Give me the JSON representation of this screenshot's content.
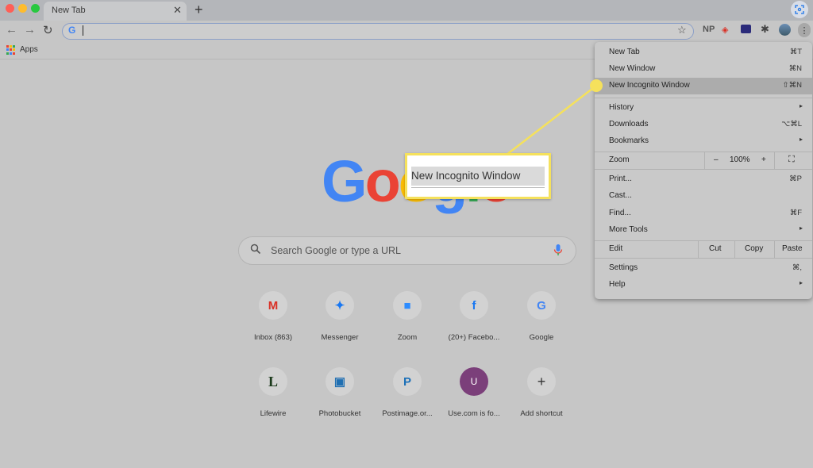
{
  "browser": {
    "tab_title": "New Tab",
    "tab_close": "✕",
    "new_tab": "+",
    "extensions": {
      "np": "NP"
    }
  },
  "bookmarks": {
    "apps_label": "Apps"
  },
  "logo": {
    "letters": [
      "G",
      "o",
      "o",
      "g",
      "l",
      "e"
    ],
    "colors": [
      "#4285f4",
      "#ea4335",
      "#fbbc05",
      "#4285f4",
      "#34a853",
      "#ea4335"
    ]
  },
  "search": {
    "placeholder": "Search Google or type a URL"
  },
  "shortcuts": [
    {
      "label": "Inbox (863)",
      "glyph": "M",
      "color": "#d93025",
      "icon": "gmail-icon"
    },
    {
      "label": "Messenger",
      "glyph": "✦",
      "color": "#1877f2",
      "icon": "messenger-icon"
    },
    {
      "label": "Zoom",
      "glyph": "■",
      "color": "#2d8cff",
      "icon": "zoom-icon"
    },
    {
      "label": "(20+) Facebo...",
      "glyph": "f",
      "color": "#1877f2",
      "icon": "facebook-icon"
    },
    {
      "label": "Google",
      "glyph": "G",
      "color": "#4285f4",
      "icon": "google-icon"
    },
    {
      "label": "Lifewire",
      "glyph": "L",
      "color": "#1b3a1b",
      "icon": "lifewire-icon"
    },
    {
      "label": "Photobucket",
      "glyph": "▣",
      "color": "#1f6fb2",
      "icon": "photobucket-icon"
    },
    {
      "label": "Postimage.or...",
      "glyph": "P",
      "color": "#1c70b8",
      "icon": "postimage-icon"
    },
    {
      "label": "Use.com is fo...",
      "glyph": "U",
      "color": "#ffffff",
      "icon": "usecom-icon"
    },
    {
      "label": "Add shortcut",
      "glyph": "+",
      "color": "#333333",
      "icon": "plus-icon"
    }
  ],
  "menu": {
    "new_tab": {
      "label": "New Tab",
      "shortcut": "⌘T"
    },
    "new_window": {
      "label": "New Window",
      "shortcut": "⌘N"
    },
    "new_incognito": {
      "label": "New Incognito Window",
      "shortcut": "⇧⌘N"
    },
    "history": {
      "label": "History"
    },
    "downloads": {
      "label": "Downloads",
      "shortcut": "⌥⌘L"
    },
    "bookmarks": {
      "label": "Bookmarks"
    },
    "zoom": {
      "label": "Zoom",
      "minus": "–",
      "level": "100%",
      "plus": "+"
    },
    "print": {
      "label": "Print...",
      "shortcut": "⌘P"
    },
    "cast": {
      "label": "Cast..."
    },
    "find": {
      "label": "Find...",
      "shortcut": "⌘F"
    },
    "more_tools": {
      "label": "More Tools"
    },
    "edit": {
      "label": "Edit",
      "cut": "Cut",
      "copy": "Copy",
      "paste": "Paste"
    },
    "settings": {
      "label": "Settings",
      "shortcut": "⌘,"
    },
    "help": {
      "label": "Help"
    },
    "submenu_arrow": "▸"
  },
  "callout": {
    "text": "New Incognito Window",
    "color": "#f5e15c"
  }
}
